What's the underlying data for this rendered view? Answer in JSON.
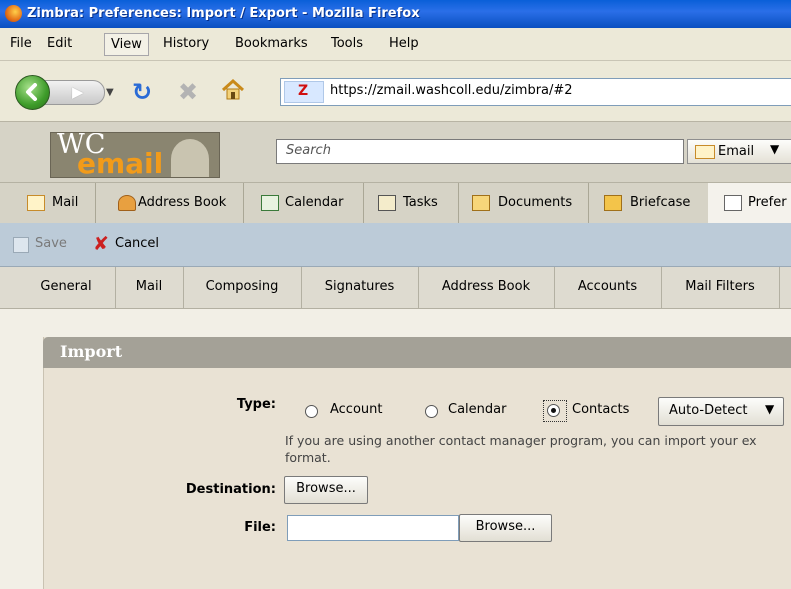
{
  "window": {
    "title": "Zimbra: Preferences: Import / Export - Mozilla Firefox"
  },
  "menu": [
    "File",
    "Edit",
    "View",
    "History",
    "Bookmarks",
    "Tools",
    "Help"
  ],
  "nav": {
    "url": "https://zmail.washcoll.edu/zimbra/#2",
    "favicon_text": "Z"
  },
  "header": {
    "logo_wc": "WC",
    "logo_email": "email",
    "search_placeholder": "Search",
    "search_type": "Email"
  },
  "app_tabs": [
    {
      "label": "Mail",
      "icon": "envelope-icon"
    },
    {
      "label": "Address Book",
      "icon": "person-icon"
    },
    {
      "label": "Calendar",
      "icon": "calendar-icon"
    },
    {
      "label": "Tasks",
      "icon": "tasks-icon"
    },
    {
      "label": "Documents",
      "icon": "documents-icon"
    },
    {
      "label": "Briefcase",
      "icon": "folder-icon"
    },
    {
      "label": "Prefer",
      "icon": "preferences-icon"
    }
  ],
  "toolbar": {
    "save_label": "Save",
    "cancel_label": "Cancel"
  },
  "pref_tabs": [
    "General",
    "Mail",
    "Composing",
    "Signatures",
    "Address Book",
    "Accounts",
    "Mail Filters"
  ],
  "import": {
    "title": "Import",
    "type_label": "Type:",
    "type_options": [
      {
        "label": "Account",
        "selected": false
      },
      {
        "label": "Calendar",
        "selected": false
      },
      {
        "label": "Contacts",
        "selected": true
      }
    ],
    "format_select": "Auto-Detect",
    "hint_line1": "If you are using another contact manager program, you can import your ex",
    "hint_line2": "format.",
    "destination_label": "Destination:",
    "destination_button": "Browse...",
    "file_label": "File:",
    "file_value": "",
    "file_button": "Browse..."
  },
  "colors": {
    "titlebar": "#0a5fd8",
    "toolbar": "#bccbd8",
    "panel_header": "#a4a197",
    "panel_bg": "#e9e2d4",
    "logo_orange": "#f29b1a"
  }
}
